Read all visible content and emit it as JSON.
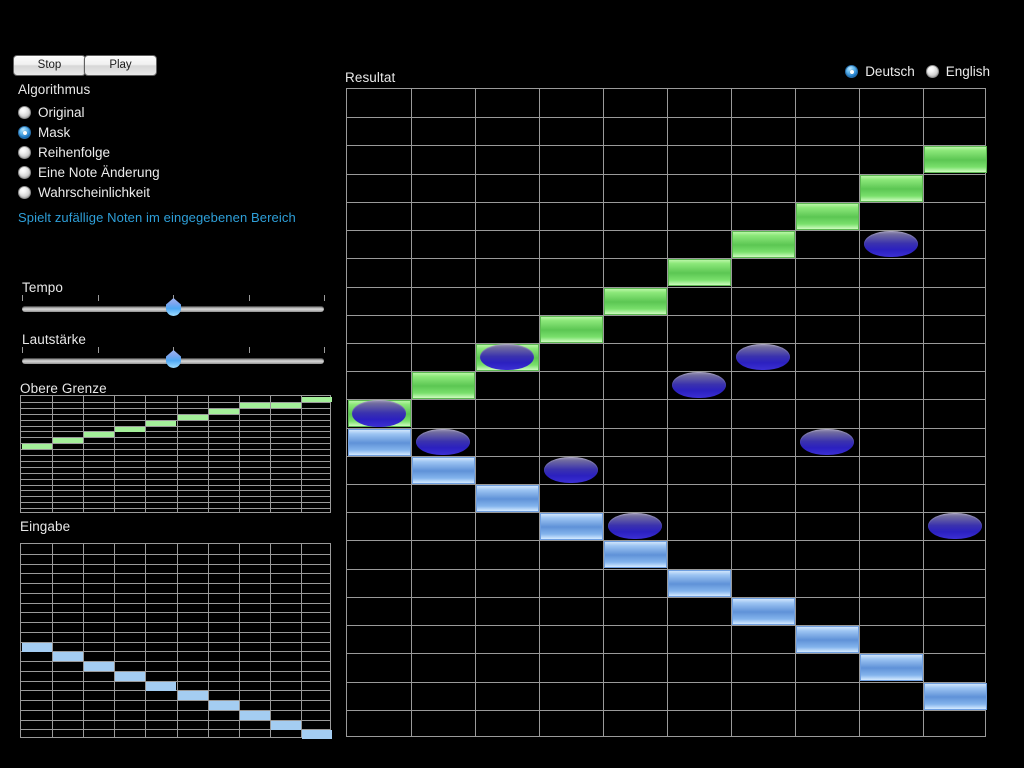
{
  "transport": {
    "stop_label": "Stop",
    "play_label": "Play"
  },
  "algorithm": {
    "title": "Algorithmus",
    "options": [
      {
        "label": "Original",
        "selected": false
      },
      {
        "label": "Mask",
        "selected": true
      },
      {
        "label": "Reihenfolge",
        "selected": false
      },
      {
        "label": "Eine Note Änderung",
        "selected": false
      },
      {
        "label": "Wahrscheinlichkeit",
        "selected": false
      }
    ],
    "hint": "Spielt zufällige Noten im eingegebenen Bereich",
    "hint_color": "#2e9fd8"
  },
  "sliders": [
    {
      "name": "tempo",
      "label": "Tempo",
      "value_pct": 50,
      "ticks": 5
    },
    {
      "name": "volume",
      "label": "Lautstärke",
      "value_pct": 50,
      "ticks": 5
    }
  ],
  "language": {
    "options": [
      {
        "label": "Deutsch",
        "selected": true
      },
      {
        "label": "English",
        "selected": false
      }
    ]
  },
  "panels": {
    "upper_limit_label": "Obere Grenze",
    "input_label": "Eingabe",
    "result_label": "Resultat"
  },
  "colors": {
    "background": "#000000",
    "grid_line": "#9a9a9a",
    "note_green": "#8ce87a",
    "note_blue": "#9cc4f2",
    "note_pill": "#3a32ae",
    "text": "#e8e8e8",
    "accent": "#2e9fd8"
  },
  "chart_data": {
    "type": "heatmap",
    "title": "Resultat",
    "grids": [
      {
        "name": "obere-grenze",
        "label": "Obere Grenze",
        "cols": 10,
        "rows": 20,
        "notes": [
          {
            "col": 0,
            "row": 8,
            "kind": "green"
          },
          {
            "col": 1,
            "row": 7,
            "kind": "green"
          },
          {
            "col": 2,
            "row": 6,
            "kind": "green"
          },
          {
            "col": 3,
            "row": 5,
            "kind": "green"
          },
          {
            "col": 4,
            "row": 4,
            "kind": "green"
          },
          {
            "col": 5,
            "row": 3,
            "kind": "green"
          },
          {
            "col": 6,
            "row": 2,
            "kind": "green"
          },
          {
            "col": 7,
            "row": 1,
            "kind": "green"
          },
          {
            "col": 8,
            "row": 1,
            "kind": "green"
          },
          {
            "col": 9,
            "row": 0,
            "kind": "green"
          }
        ]
      },
      {
        "name": "eingabe",
        "label": "Eingabe",
        "cols": 10,
        "rows": 20,
        "notes": [
          {
            "col": 0,
            "row": 10,
            "kind": "blue"
          },
          {
            "col": 1,
            "row": 11,
            "kind": "blue"
          },
          {
            "col": 2,
            "row": 12,
            "kind": "blue"
          },
          {
            "col": 3,
            "row": 13,
            "kind": "blue"
          },
          {
            "col": 4,
            "row": 14,
            "kind": "blue"
          },
          {
            "col": 5,
            "row": 15,
            "kind": "blue"
          },
          {
            "col": 6,
            "row": 16,
            "kind": "blue"
          },
          {
            "col": 7,
            "row": 17,
            "kind": "blue"
          },
          {
            "col": 8,
            "row": 18,
            "kind": "blue"
          },
          {
            "col": 9,
            "row": 19,
            "kind": "blue"
          }
        ]
      },
      {
        "name": "resultat",
        "label": "Resultat",
        "cols": 10,
        "rows": 23,
        "notes": [
          {
            "col": 0,
            "row": 11,
            "kind": "green"
          },
          {
            "col": 1,
            "row": 10,
            "kind": "green"
          },
          {
            "col": 2,
            "row": 9,
            "kind": "green"
          },
          {
            "col": 3,
            "row": 8,
            "kind": "green"
          },
          {
            "col": 4,
            "row": 7,
            "kind": "green"
          },
          {
            "col": 5,
            "row": 6,
            "kind": "green"
          },
          {
            "col": 6,
            "row": 5,
            "kind": "green"
          },
          {
            "col": 7,
            "row": 4,
            "kind": "green"
          },
          {
            "col": 8,
            "row": 3,
            "kind": "green"
          },
          {
            "col": 9,
            "row": 2,
            "kind": "green"
          },
          {
            "col": 0,
            "row": 12,
            "kind": "blue"
          },
          {
            "col": 1,
            "row": 13,
            "kind": "blue"
          },
          {
            "col": 2,
            "row": 14,
            "kind": "blue"
          },
          {
            "col": 3,
            "row": 15,
            "kind": "blue"
          },
          {
            "col": 4,
            "row": 16,
            "kind": "blue"
          },
          {
            "col": 5,
            "row": 17,
            "kind": "blue"
          },
          {
            "col": 6,
            "row": 18,
            "kind": "blue"
          },
          {
            "col": 7,
            "row": 19,
            "kind": "blue"
          },
          {
            "col": 8,
            "row": 20,
            "kind": "blue"
          },
          {
            "col": 9,
            "row": 21,
            "kind": "blue"
          },
          {
            "col": 0,
            "row": 11,
            "kind": "pill"
          },
          {
            "col": 1,
            "row": 12,
            "kind": "pill"
          },
          {
            "col": 2,
            "row": 9,
            "kind": "pill"
          },
          {
            "col": 3,
            "row": 13,
            "kind": "pill"
          },
          {
            "col": 4,
            "row": 15,
            "kind": "pill"
          },
          {
            "col": 5,
            "row": 10,
            "kind": "pill"
          },
          {
            "col": 6,
            "row": 9,
            "kind": "pill"
          },
          {
            "col": 7,
            "row": 12,
            "kind": "pill"
          },
          {
            "col": 8,
            "row": 5,
            "kind": "pill"
          },
          {
            "col": 9,
            "row": 15,
            "kind": "pill"
          }
        ]
      }
    ]
  }
}
